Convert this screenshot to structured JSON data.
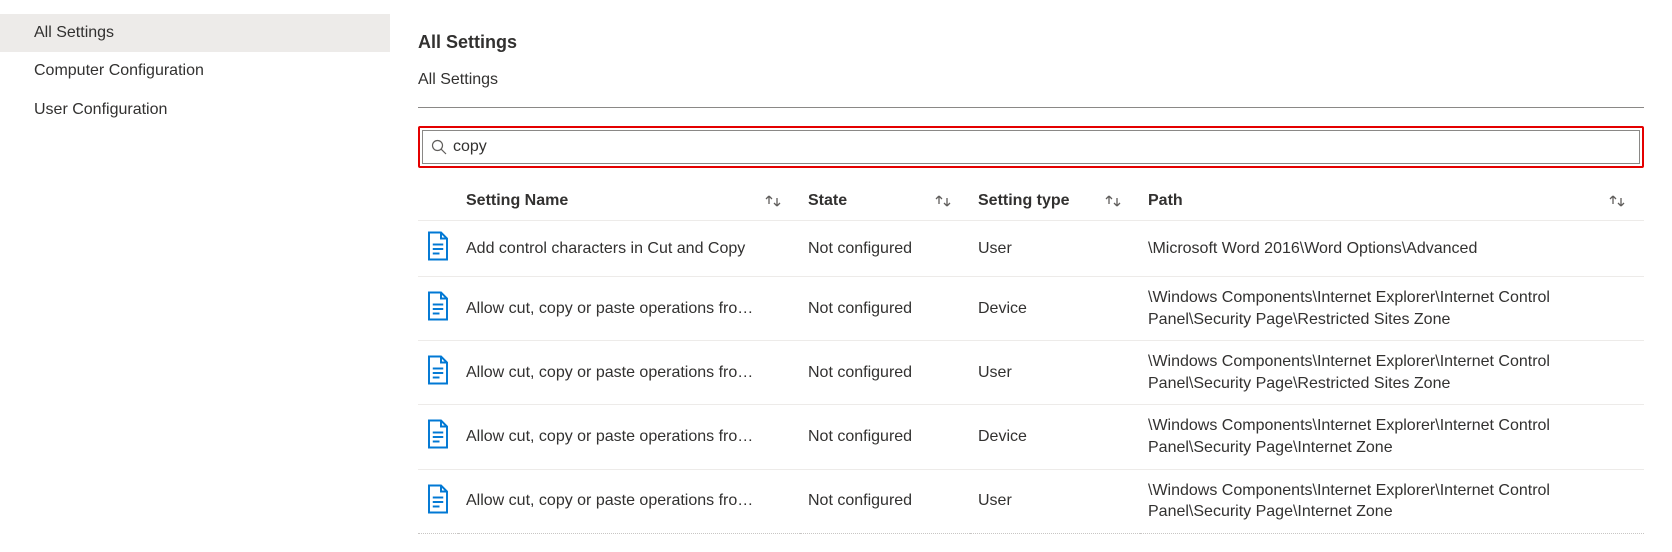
{
  "sidebar": {
    "items": [
      {
        "label": "All Settings",
        "active": true
      },
      {
        "label": "Computer Configuration",
        "active": false
      },
      {
        "label": "User Configuration",
        "active": false
      }
    ]
  },
  "header": {
    "title": "All Settings",
    "breadcrumb": "All Settings"
  },
  "search": {
    "value": "copy"
  },
  "table": {
    "columns": {
      "name": "Setting Name",
      "state": "State",
      "type": "Setting type",
      "path": "Path"
    },
    "rows": [
      {
        "name": "Add control characters in Cut and Copy",
        "state": "Not configured",
        "type": "User",
        "path": "\\Microsoft Word 2016\\Word Options\\Advanced"
      },
      {
        "name": "Allow cut, copy or paste operations fro…",
        "state": "Not configured",
        "type": "Device",
        "path": "\\Windows Components\\Internet Explorer\\Internet Control Panel\\Security Page\\Restricted Sites Zone"
      },
      {
        "name": "Allow cut, copy or paste operations fro…",
        "state": "Not configured",
        "type": "User",
        "path": "\\Windows Components\\Internet Explorer\\Internet Control Panel\\Security Page\\Restricted Sites Zone"
      },
      {
        "name": "Allow cut, copy or paste operations fro…",
        "state": "Not configured",
        "type": "Device",
        "path": "\\Windows Components\\Internet Explorer\\Internet Control Panel\\Security Page\\Internet Zone"
      },
      {
        "name": "Allow cut, copy or paste operations fro…",
        "state": "Not configured",
        "type": "User",
        "path": "\\Windows Components\\Internet Explorer\\Internet Control Panel\\Security Page\\Internet Zone"
      }
    ]
  }
}
